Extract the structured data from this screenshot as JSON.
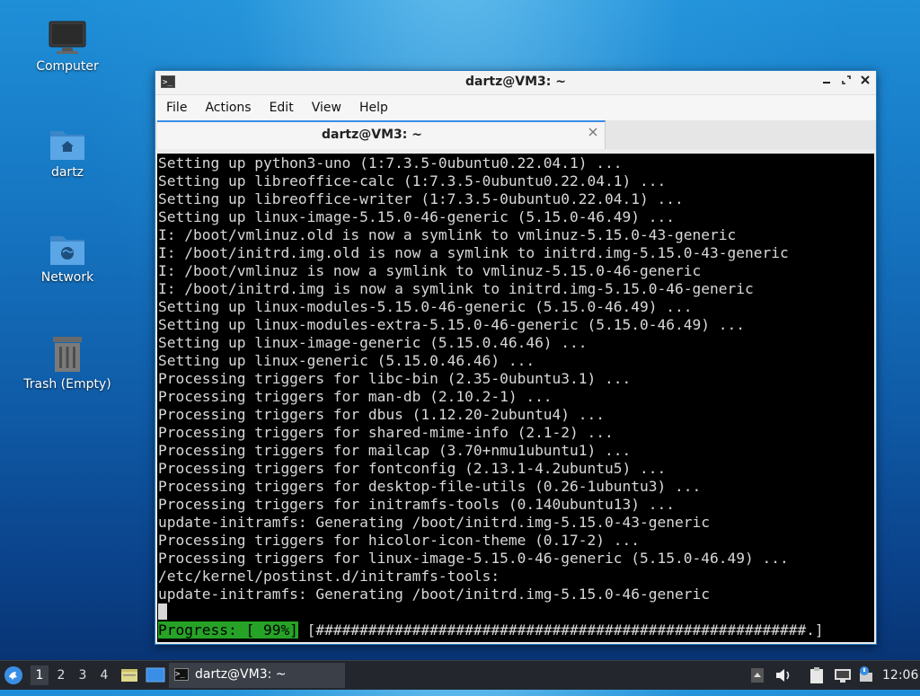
{
  "desktop": {
    "icons": [
      {
        "label": "Computer"
      },
      {
        "label": "dartz"
      },
      {
        "label": "Network"
      },
      {
        "label": "Trash (Empty)"
      }
    ]
  },
  "window": {
    "title": "dartz@VM3: ~",
    "menu": [
      "File",
      "Actions",
      "Edit",
      "View",
      "Help"
    ],
    "tab_title": "dartz@VM3: ~",
    "terminal_lines": [
      "Setting up python3-uno (1:7.3.5-0ubuntu0.22.04.1) ...",
      "Setting up libreoffice-calc (1:7.3.5-0ubuntu0.22.04.1) ...",
      "Setting up libreoffice-writer (1:7.3.5-0ubuntu0.22.04.1) ...",
      "Setting up linux-image-5.15.0-46-generic (5.15.0-46.49) ...",
      "I: /boot/vmlinuz.old is now a symlink to vmlinuz-5.15.0-43-generic",
      "I: /boot/initrd.img.old is now a symlink to initrd.img-5.15.0-43-generic",
      "I: /boot/vmlinuz is now a symlink to vmlinuz-5.15.0-46-generic",
      "I: /boot/initrd.img is now a symlink to initrd.img-5.15.0-46-generic",
      "Setting up linux-modules-5.15.0-46-generic (5.15.0-46.49) ...",
      "Setting up linux-modules-extra-5.15.0-46-generic (5.15.0-46.49) ...",
      "Setting up linux-image-generic (5.15.0.46.46) ...",
      "Setting up linux-generic (5.15.0.46.46) ...",
      "Processing triggers for libc-bin (2.35-0ubuntu3.1) ...",
      "Processing triggers for man-db (2.10.2-1) ...",
      "Processing triggers for dbus (1.12.20-2ubuntu4) ...",
      "Processing triggers for shared-mime-info (2.1-2) ...",
      "Processing triggers for mailcap (3.70+nmu1ubuntu1) ...",
      "Processing triggers for fontconfig (2.13.1-4.2ubuntu5) ...",
      "Processing triggers for desktop-file-utils (0.26-1ubuntu3) ...",
      "Processing triggers for initramfs-tools (0.140ubuntu13) ...",
      "update-initramfs: Generating /boot/initrd.img-5.15.0-43-generic",
      "Processing triggers for hicolor-icon-theme (0.17-2) ...",
      "Processing triggers for linux-image-5.15.0-46-generic (5.15.0-46.49) ...",
      "/etc/kernel/postinst.d/initramfs-tools:",
      "update-initramfs: Generating /boot/initrd.img-5.15.0-46-generic"
    ],
    "progress_label": "Progress: [ 99%]",
    "progress_bar": " [########################################################.]"
  },
  "taskbar": {
    "workspaces": [
      "1",
      "2",
      "3",
      "4"
    ],
    "active_workspace": "1",
    "task_title": "dartz@VM3: ~",
    "clock": "12:06"
  },
  "colors": {
    "accent": "#3a8ee6",
    "progress_green": "#26a326",
    "terminal_bg": "#000000"
  }
}
